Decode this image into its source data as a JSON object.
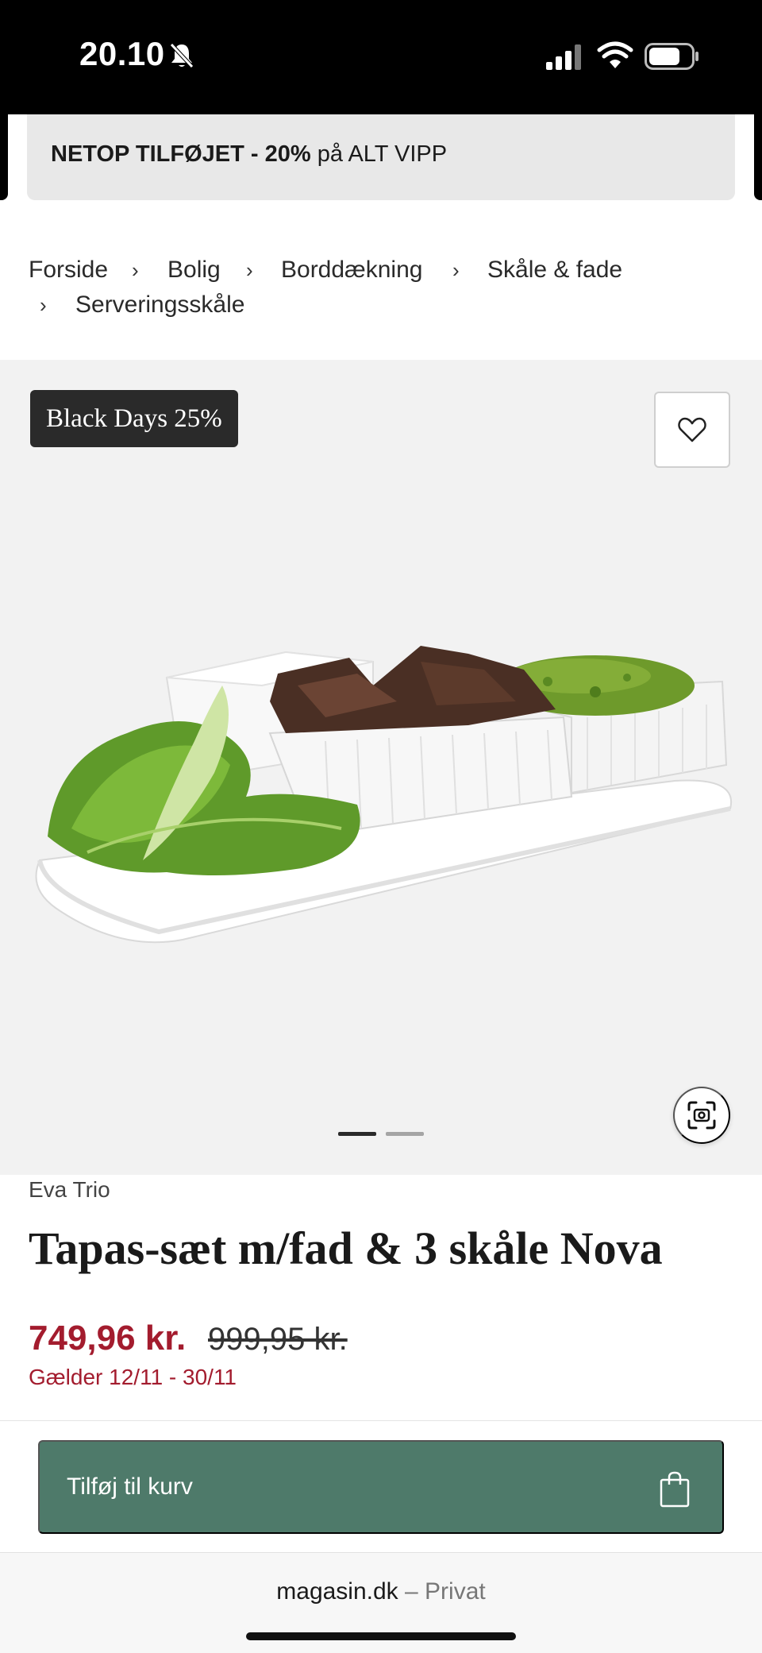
{
  "status_bar": {
    "time": "20.10",
    "icons": [
      "bell-slash-icon",
      "signal-icon",
      "wifi-icon",
      "battery-icon"
    ]
  },
  "promo": {
    "bold_text": "NETOP TILFØJET - 20%",
    "text": " på ALT VIPP"
  },
  "breadcrumb": {
    "items": [
      "Forside",
      "Bolig",
      "Borddækning",
      "Skåle & fade",
      "Serveringsskåle"
    ],
    "separator": "›"
  },
  "gallery": {
    "badge": "Black Days 25%",
    "image_count": 2,
    "active_index": 0,
    "icons": [
      "heart-icon",
      "visual-search-icon"
    ]
  },
  "product": {
    "brand": "Eva Trio",
    "title": "Tapas-sæt m/fad & 3 skåle Nova",
    "price_now": "749,96 kr.",
    "price_old": "999,95 kr.",
    "valid_period": "Gælder 12/11 - 30/11"
  },
  "cart": {
    "button_label": "Tilføj til kurv",
    "icon": "shopping-bag-icon"
  },
  "browser": {
    "domain": "magasin.dk",
    "separator": " – ",
    "mode": "Privat"
  },
  "colors": {
    "sale_red": "#a31c2e",
    "cart_green": "#4e7a6a",
    "badge_dark": "#2a2a2a",
    "gallery_bg": "#f2f2f2"
  }
}
